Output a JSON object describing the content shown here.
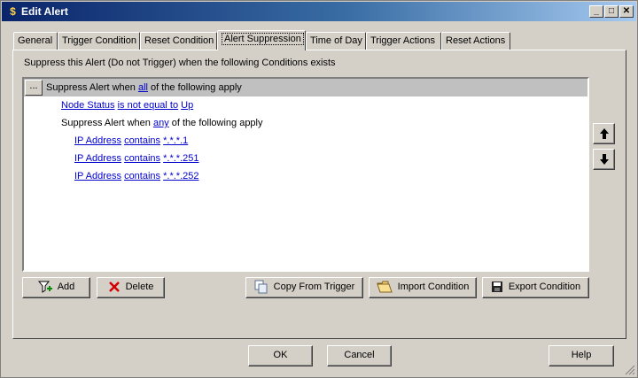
{
  "window": {
    "title": "Edit Alert"
  },
  "tabs": [
    {
      "label": "General"
    },
    {
      "label": "Trigger Condition"
    },
    {
      "label": "Reset Condition"
    },
    {
      "label": "Alert Suppression"
    },
    {
      "label": "Time of Day"
    },
    {
      "label": "Trigger Actions"
    },
    {
      "label": "Reset Actions"
    }
  ],
  "active_tab": "Alert Suppression",
  "panel": {
    "caption": "Suppress this Alert (Do not Trigger) when the following Conditions exists",
    "conditions": {
      "root": {
        "ellipsis": "...",
        "prefix": "Suppress Alert when",
        "quantifier": "all",
        "suffix": "of the following apply"
      },
      "node_status": {
        "field": "Node Status",
        "operator": "is not equal to",
        "value": "Up"
      },
      "group": {
        "prefix": "Suppress Alert when",
        "quantifier": "any",
        "suffix": "of the following apply",
        "items": [
          {
            "field": "IP Address",
            "operator": "contains",
            "value": "*.*.*.1"
          },
          {
            "field": "IP Address",
            "operator": "contains",
            "value": "*.*.*.251"
          },
          {
            "field": "IP Address",
            "operator": "contains",
            "value": "*.*.*.252"
          }
        ]
      }
    },
    "buttons": {
      "add": "Add",
      "delete": "Delete",
      "copy_from_trigger": "Copy From Trigger",
      "import_condition": "Import Condition",
      "export_condition": "Export Condition"
    }
  },
  "footer": {
    "ok": "OK",
    "cancel": "Cancel",
    "help": "Help"
  },
  "colors": {
    "link": "#0000cc",
    "title_start": "#0a246a",
    "title_end": "#a6caf0",
    "face": "#d4d0c8"
  }
}
